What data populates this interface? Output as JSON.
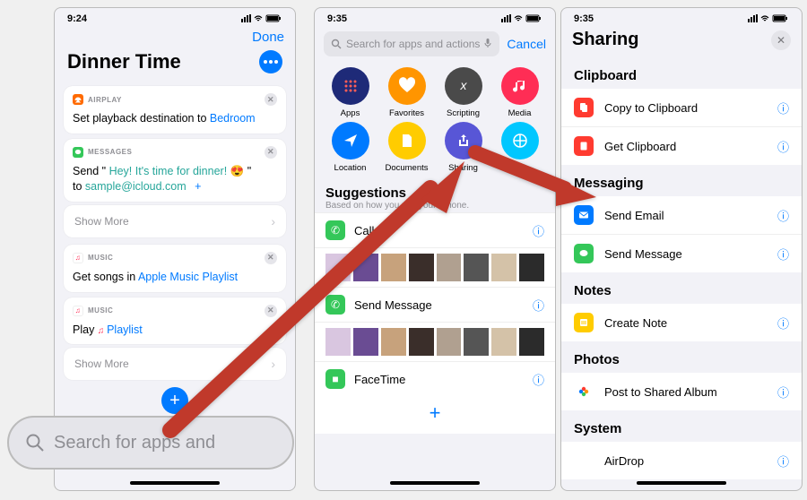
{
  "status": {
    "time1": "9:24",
    "time2": "9:35",
    "time3": "9:35"
  },
  "phone1": {
    "done": "Done",
    "title": "Dinner Time",
    "airplay": {
      "label": "AIRPLAY",
      "body_prefix": "Set playback destination to ",
      "dest": "Bedroom"
    },
    "messages": {
      "label": "MESSAGES",
      "prefix": "Send \" ",
      "msg1": "Hey!  It's time for dinner! ",
      "emoji": "😍",
      "suffix": " \"",
      "to_label": "to ",
      "to_addr": "sample@icloud.com",
      "plus": "+"
    },
    "show_more": "Show More",
    "music1": {
      "label": "MUSIC",
      "prefix": "Get songs in ",
      "val": "Apple Music Playlist"
    },
    "music2": {
      "label": "MUSIC",
      "prefix": "Play ",
      "val": "Playlist"
    }
  },
  "search_pill": "Search for apps and",
  "phone2": {
    "search_placeholder": "Search for apps and actions",
    "cancel": "Cancel",
    "cats": [
      {
        "name": "Apps",
        "color": "#1e2a78"
      },
      {
        "name": "Favorites",
        "color": "#ff9500"
      },
      {
        "name": "Scripting",
        "color": "#4a4a4a"
      },
      {
        "name": "Media",
        "color": "#ff2d55"
      },
      {
        "name": "Location",
        "color": "#007aff"
      },
      {
        "name": "Documents",
        "color": "#ffcc00"
      },
      {
        "name": "Sharing",
        "color": "#5856d6"
      },
      {
        "name": "Web",
        "color": "#00c7ff"
      }
    ],
    "sugg_title": "Suggestions",
    "sugg_sub": "Based on how you use your iPhone.",
    "sugg": [
      {
        "label": "Call",
        "color": "#34c759"
      },
      {
        "label": "Send Message",
        "color": "#34c759"
      },
      {
        "label": "FaceTime",
        "color": "#34c759"
      }
    ]
  },
  "phone3": {
    "title": "Sharing",
    "sections": [
      {
        "header": "Clipboard",
        "items": [
          {
            "label": "Copy to Clipboard",
            "color": "#ff3b30"
          },
          {
            "label": "Get Clipboard",
            "color": "#ff3b30"
          }
        ]
      },
      {
        "header": "Messaging",
        "items": [
          {
            "label": "Send Email",
            "color": "#007aff"
          },
          {
            "label": "Send Message",
            "color": "#34c759"
          }
        ]
      },
      {
        "header": "Notes",
        "items": [
          {
            "label": "Create Note",
            "color": "#ffcc00"
          }
        ]
      },
      {
        "header": "Photos",
        "items": [
          {
            "label": "Post to Shared Album",
            "color": "#ffffff"
          }
        ]
      },
      {
        "header": "System",
        "items": [
          {
            "label": "AirDrop",
            "color": "#ffffff"
          }
        ]
      }
    ]
  }
}
